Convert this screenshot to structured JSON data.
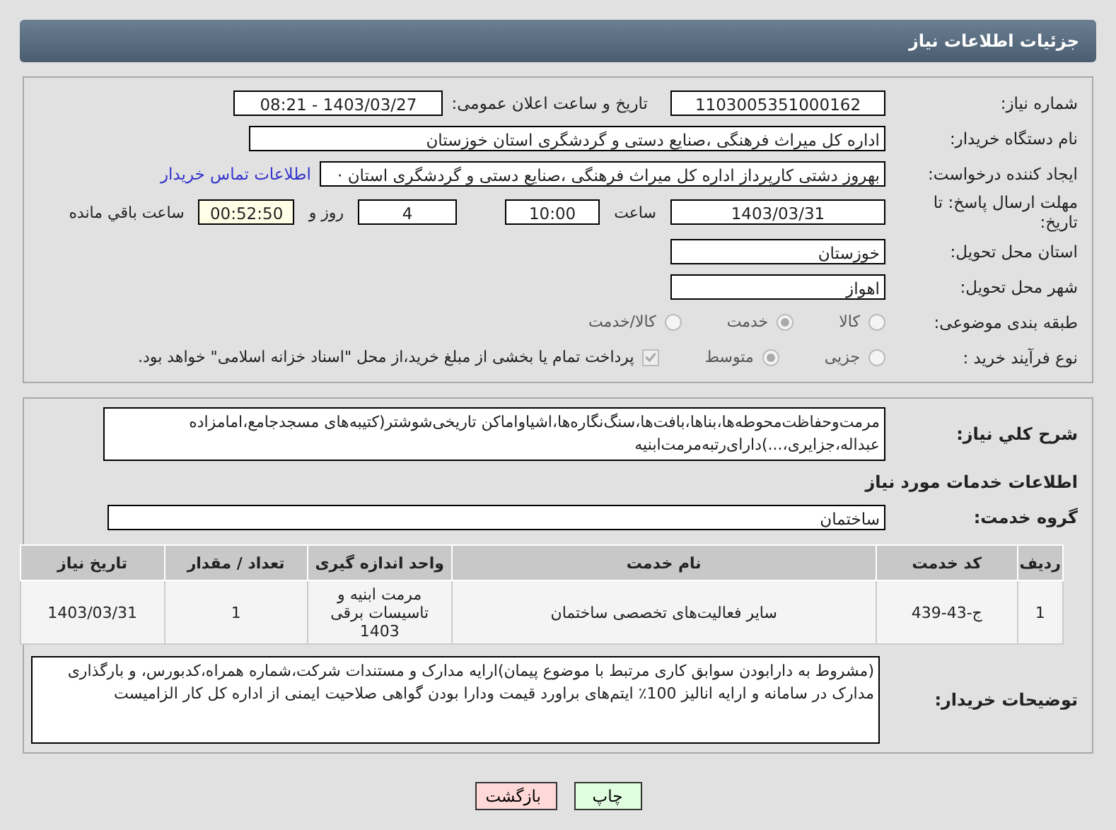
{
  "header": {
    "title": "جزئیات اطلاعات نیاز"
  },
  "details": {
    "need_number": {
      "label": "شماره نیاز:",
      "value": "1103005351000162"
    },
    "announce": {
      "label": "تاریخ و ساعت اعلان عمومی:",
      "value": "1403/03/27 - 08:21"
    },
    "buyer": {
      "label": "نام دستگاه خریدار:",
      "value": "اداره کل میراث فرهنگی ،صنایع دستی و گردشگری استان خوزستان"
    },
    "requester": {
      "label": "ایجاد کننده درخواست:",
      "value": "بهروز دشتی کارپرداز اداره کل میراث فرهنگی ،صنایع دستی و گردشگری استان ·",
      "link": "اطلاعات تماس خریدار"
    },
    "deadline": {
      "label": "مهلت ارسال پاسخ: تا تاریخ:",
      "date": "1403/03/31",
      "time_label": "ساعت",
      "time": "10:00",
      "days": "4",
      "days_label": "روز و",
      "remaining": "00:52:50",
      "remaining_label": "ساعت باقي مانده"
    },
    "province": {
      "label": "استان محل تحویل:",
      "value": "خوزستان"
    },
    "city": {
      "label": "شهر محل تحویل:",
      "value": "اهواز"
    },
    "category": {
      "label": "طبقه بندی موضوعی:",
      "options": [
        {
          "label": "کالا",
          "selected": false
        },
        {
          "label": "خدمت",
          "selected": true
        },
        {
          "label": "کالا/خدمت",
          "selected": false
        }
      ]
    },
    "process": {
      "label": "نوع فرآیند خرید :",
      "options": [
        {
          "label": "جزیی",
          "selected": false
        },
        {
          "label": "متوسط",
          "selected": true
        }
      ],
      "treasury": {
        "label": "پرداخت تمام یا بخشی از مبلغ خرید،از محل \"اسناد خزانه اسلامی\" خواهد بود.",
        "checked": true
      }
    }
  },
  "need": {
    "summary_label": "شرح کلي نیاز:",
    "summary": "مرمت‌وحفاظت‌محوطه‌ها،بناها،بافت‌ها،سنگ‌نگاره‌ها،اشیاواماکن تاریخی‌شوشتر(کتیبه‌های مسجدجامع،امامزاده عبداله،جزایری،...)دارای‌رتبه‌مرمت‌ابنیه",
    "services_heading": "اطلاعات خدمات مورد نیاز",
    "group_label": "گروه خدمت:",
    "group": "ساختمان",
    "table": {
      "columns": [
        "ردیف",
        "کد خدمت",
        "نام خدمت",
        "واحد اندازه گیری",
        "تعداد / مقدار",
        "تاریخ نیاز"
      ],
      "rows": [
        [
          "1",
          "ج-43-439",
          "سایر فعالیت‌های تخصصی ساختمان",
          "مرمت ابنیه و تاسیسات برقی 1403",
          "1",
          "1403/03/31"
        ]
      ]
    },
    "notes_label": "توضیحات خریدار:",
    "notes": "(مشروط به دارابودن سوابق کاری مرتبط با موضوع پیمان)ارایه مدارک و مستندات شرکت،شماره همراه،کدبورس، و بارگذاری مدارک در سامانه و ارایه انالیز 100٪ ایتم‌های براورد قیمت ودارا بودن گواهی صلاحیت ایمنی از اداره کل کار الزامیست"
  },
  "buttons": [
    {
      "label": "چاپ",
      "kind": "print"
    },
    {
      "label": "بازگشت",
      "kind": "back"
    }
  ]
}
